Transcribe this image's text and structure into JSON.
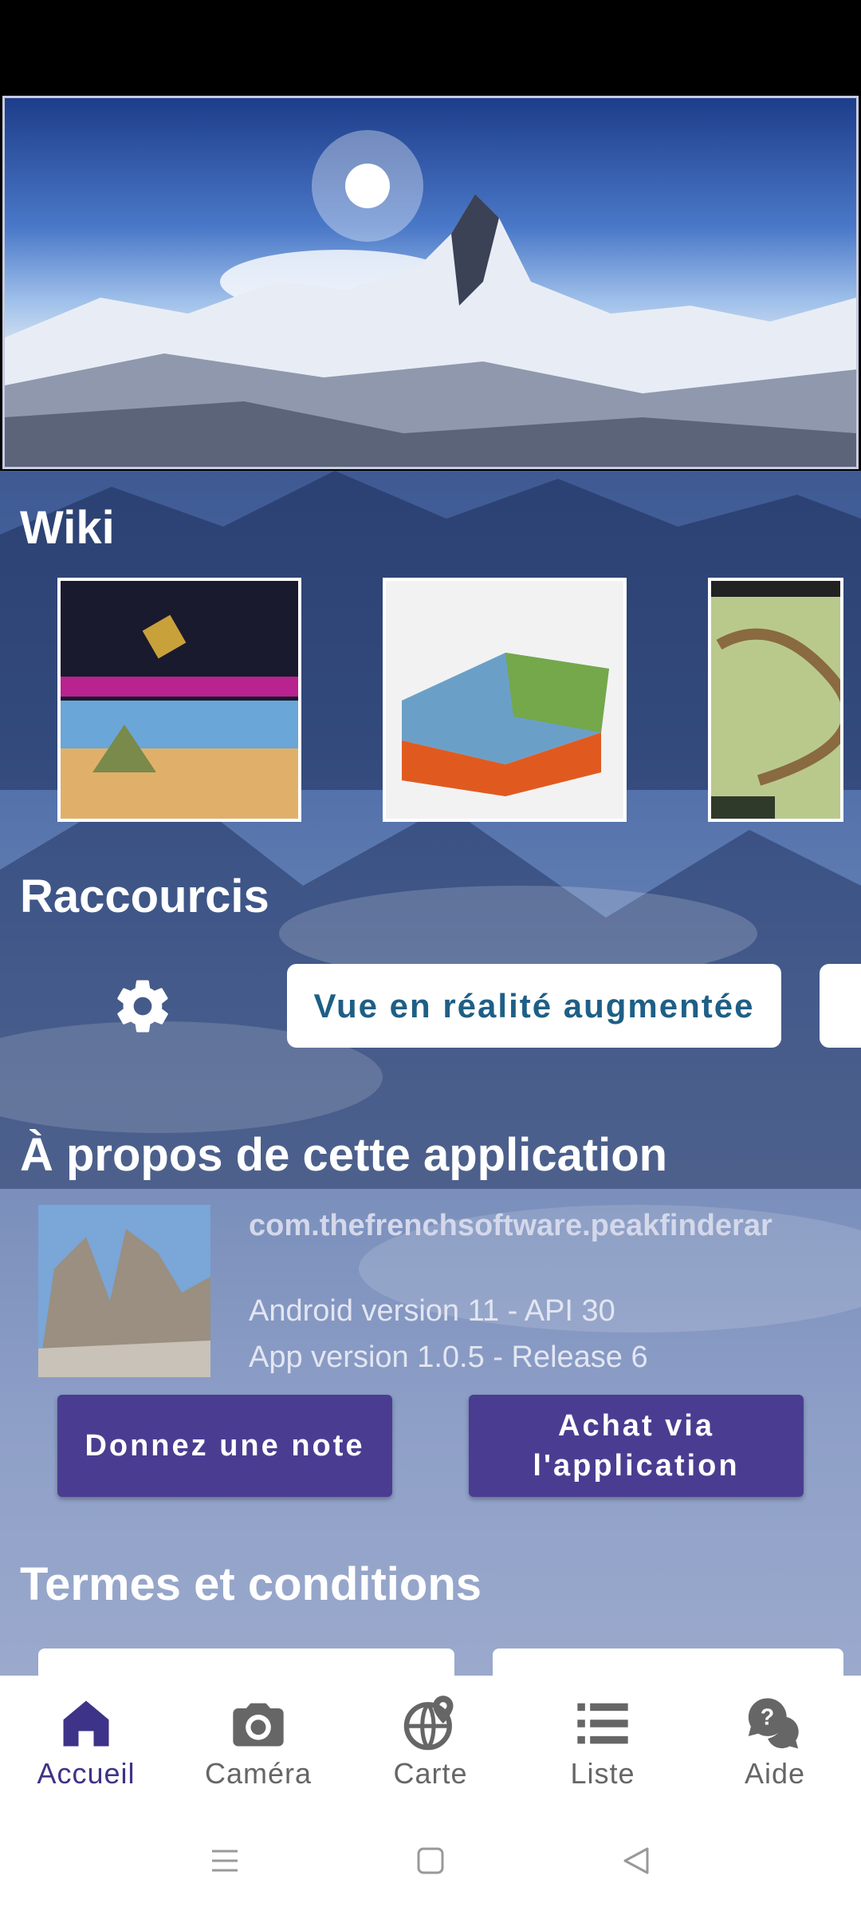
{
  "sections": {
    "wiki": "Wiki",
    "shortcuts": "Raccourcis",
    "about": "À propos de cette application",
    "terms": "Termes et conditions"
  },
  "shortcuts": {
    "ar_view": "Vue en réalité augmentée"
  },
  "about": {
    "package": "com.thefrenchsoftware.peakfinderar",
    "android_version": "Android version 11 - API 30",
    "app_version": "App version 1.0.5 - Release 6",
    "rate_button": "Donnez une note",
    "purchase_button": "Achat via l'application"
  },
  "bottom_nav": {
    "home": "Accueil",
    "camera": "Caméra",
    "map": "Carte",
    "list": "Liste",
    "help": "Aide"
  },
  "colors": {
    "accent": "#3d3388",
    "button": "#4a3d91",
    "pill_text": "#1e5f86"
  }
}
